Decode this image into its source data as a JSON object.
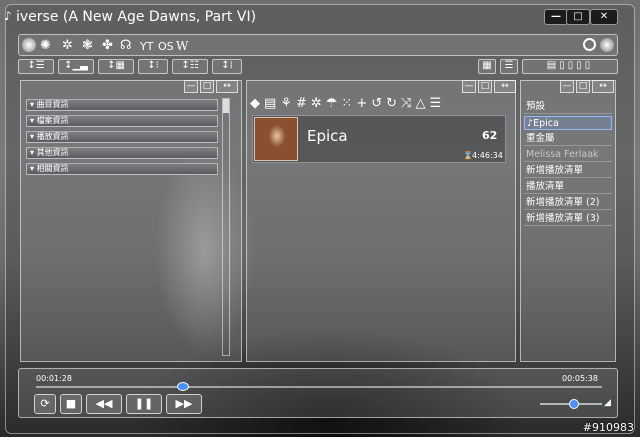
{
  "window": {
    "title": "iverse (A New Age Dawns, Part VI)",
    "controls": {
      "minimize": "—",
      "maximize": "□",
      "close": "✕"
    }
  },
  "toolbar": {
    "icons": [
      "gear-icon",
      "cog-icon",
      "flower-icon",
      "fan-icon",
      "chain-icon",
      "cs-icon",
      "gear-flower-icon"
    ],
    "letters": [
      "YT",
      "OS",
      "W"
    ]
  },
  "left_panel": {
    "items": [
      {
        "label": "曲目資訊"
      },
      {
        "label": "檔案資訊"
      },
      {
        "label": "播放資訊"
      },
      {
        "label": "其他資訊"
      },
      {
        "label": "相關資訊"
      }
    ]
  },
  "center_panel": {
    "artist": "Epica",
    "count": "62",
    "duration": "4:46:34"
  },
  "right_panel": {
    "playlists": [
      {
        "label": "預設",
        "selected": false,
        "dim": false
      },
      {
        "label": "Epica",
        "selected": true,
        "dim": false
      },
      {
        "label": "重金屬",
        "selected": false,
        "dim": false
      },
      {
        "label": "Melissa Ferlaak",
        "selected": false,
        "dim": true
      },
      {
        "label": "新增播放清單",
        "selected": false,
        "dim": false
      },
      {
        "label": "播放清單",
        "selected": false,
        "dim": false
      },
      {
        "label": "新增播放清單 (2)",
        "selected": false,
        "dim": false
      },
      {
        "label": "新增播放清單 (3)",
        "selected": false,
        "dim": false
      }
    ]
  },
  "transport": {
    "elapsed": "00:01:28",
    "remaining": "00:05:38",
    "progress": 0.26,
    "volume": 0.55
  },
  "watermark": "#910983",
  "colors": {
    "selection": "#8fb9ff",
    "seek_knob": "#4a90ff"
  }
}
